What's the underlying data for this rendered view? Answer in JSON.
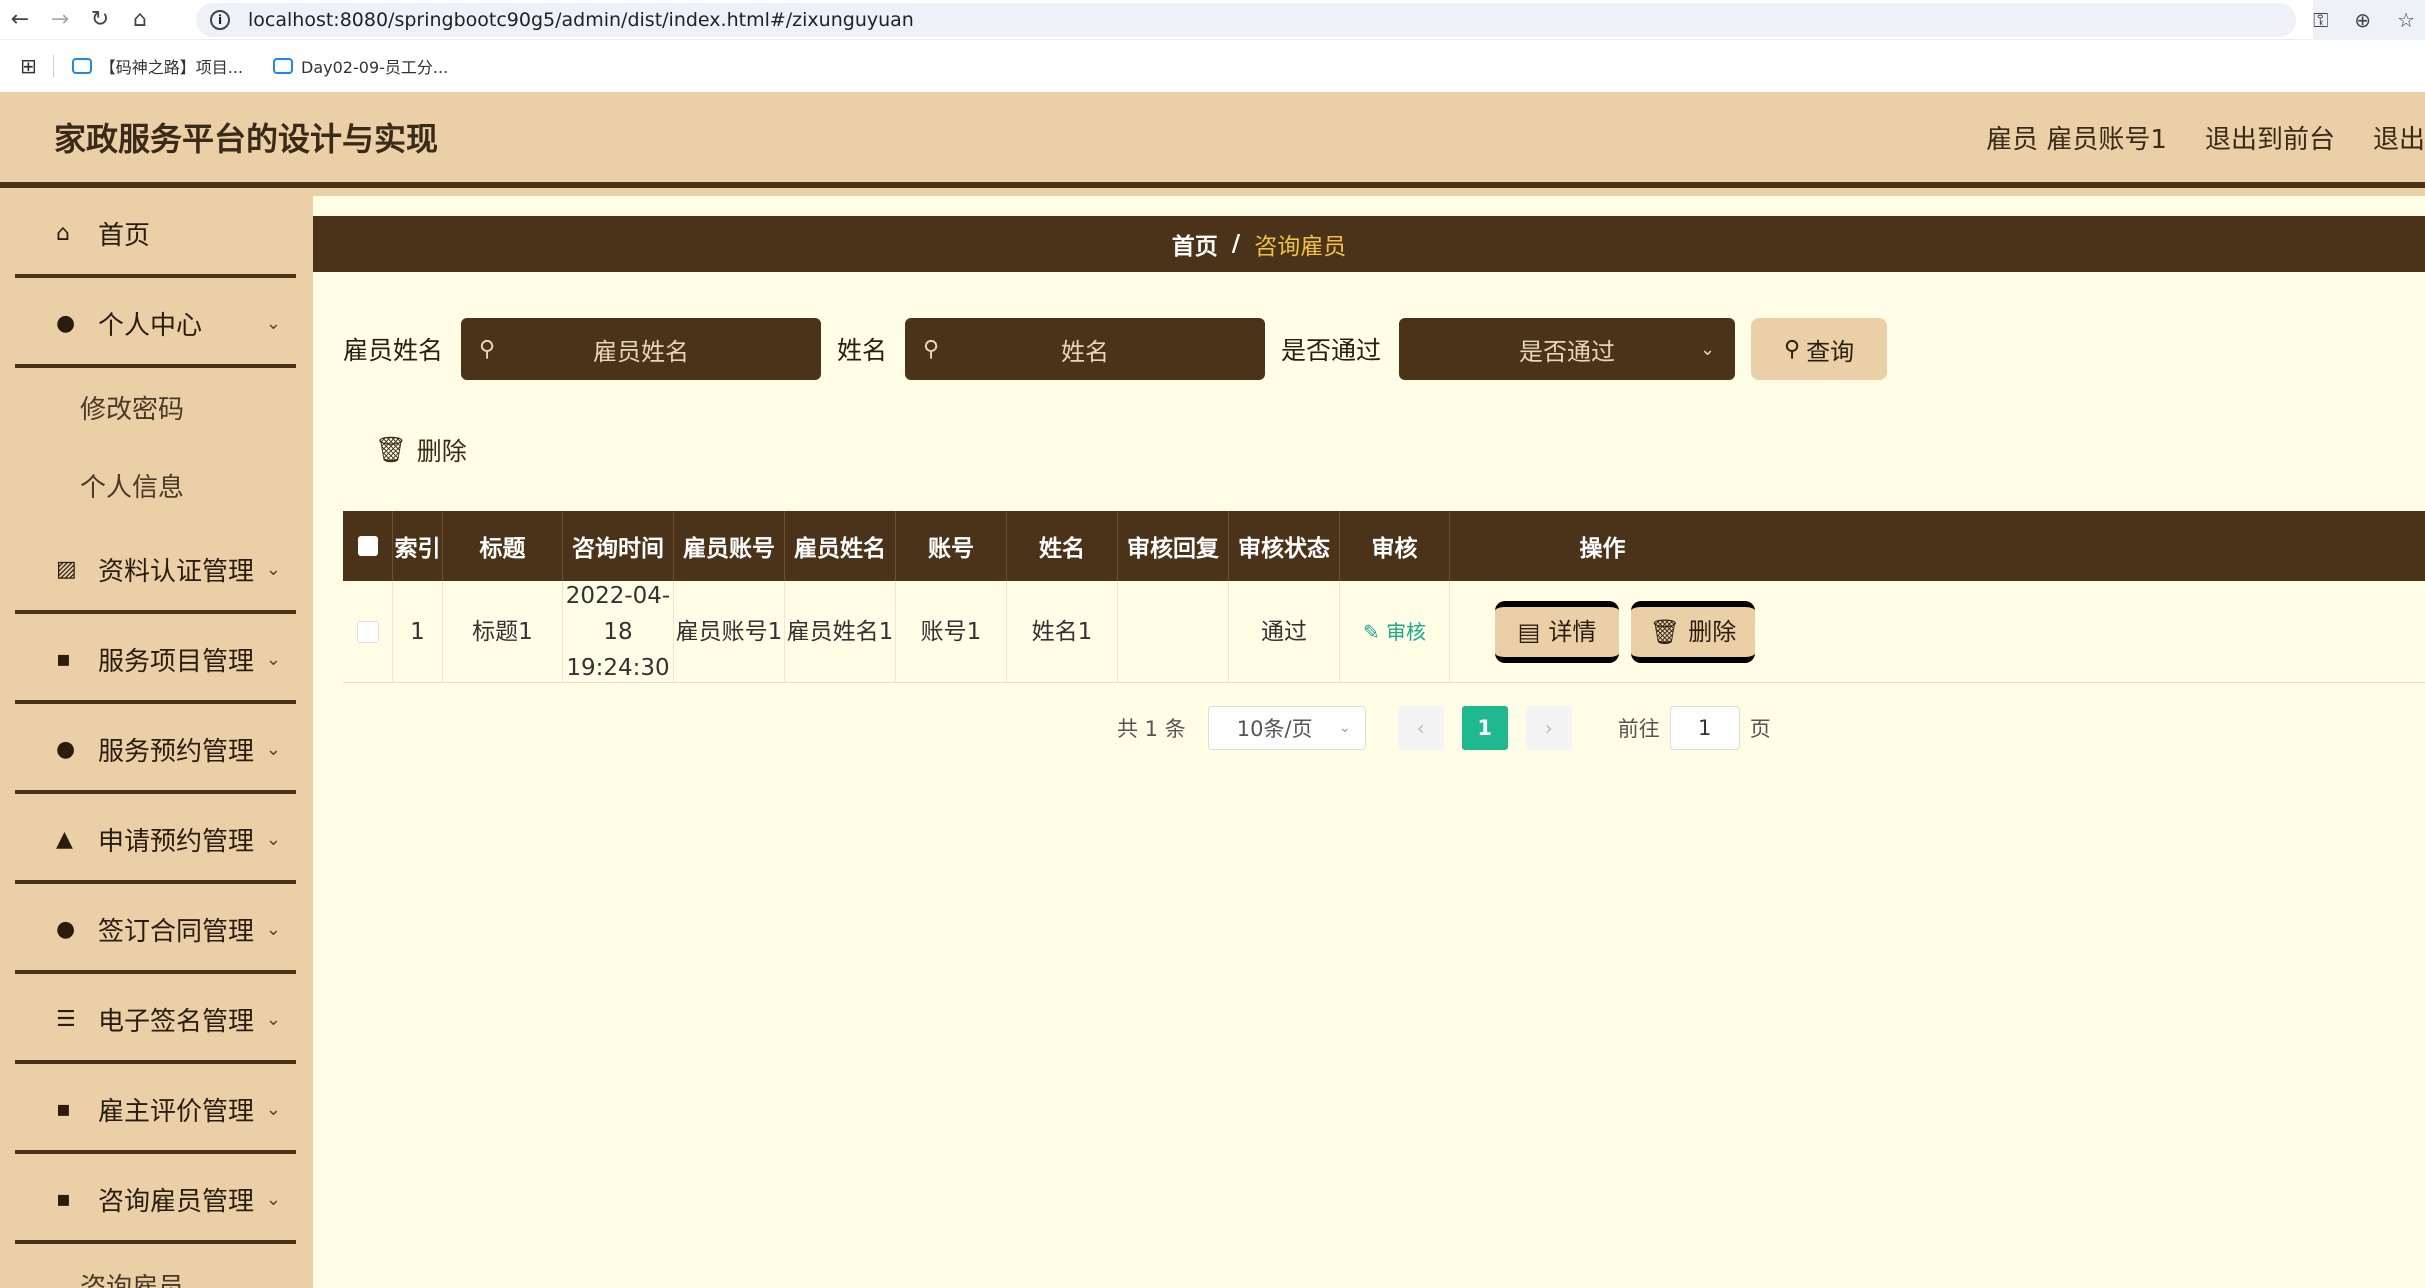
{
  "browser": {
    "url": "localhost:8080/springbootc90g5/admin/dist/index.html#/zixunguyuan",
    "bookmarks": [
      "【码神之路】项目...",
      "Day02-09-员工分..."
    ]
  },
  "header": {
    "title": "家政服务平台的设计与实现",
    "user": "雇员 雇员账号1",
    "back_front": "退出到前台",
    "logout": "退出"
  },
  "sidebar": {
    "home": "首页",
    "personal": "个人中心",
    "sub_personal": [
      "修改密码",
      "个人信息"
    ],
    "items": [
      "资料认证管理",
      "服务项目管理",
      "服务预约管理",
      "申请预约管理",
      "签订合同管理",
      "电子签名管理",
      "雇主评价管理",
      "咨询雇员管理"
    ],
    "sub_last": "咨询雇员"
  },
  "breadcrumb": {
    "home": "首页",
    "sep": "/",
    "current": "咨询雇员"
  },
  "search": {
    "label1": "雇员姓名",
    "placeholder1": "雇员姓名",
    "label2": "姓名",
    "placeholder2": "姓名",
    "label3": "是否通过",
    "placeholder3": "是否通过",
    "query": "查询"
  },
  "actions": {
    "delete": "删除"
  },
  "table": {
    "headers": [
      "索引",
      "标题",
      "咨询时间",
      "雇员账号",
      "雇员姓名",
      "账号",
      "姓名",
      "审核回复",
      "审核状态",
      "审核",
      "操作"
    ],
    "rows": [
      {
        "index": "1",
        "title": "标题1",
        "date": "2022-04-18",
        "time": "19:24:30",
        "emp_account": "雇员账号1",
        "emp_name": "雇员姓名1",
        "account": "账号1",
        "name": "姓名1",
        "reply": "",
        "status": "通过",
        "audit": "审核",
        "detail": "详情",
        "delete": "删除"
      }
    ]
  },
  "pagination": {
    "total": "共 1 条",
    "size": "10条/页",
    "page": "1",
    "goto": "前往",
    "goto_value": "1",
    "unit": "页"
  },
  "colors": {
    "sidebar": "#ebcfa6",
    "dark": "#4a3318",
    "content": "#fffde6",
    "accent": "#1fb88f"
  }
}
